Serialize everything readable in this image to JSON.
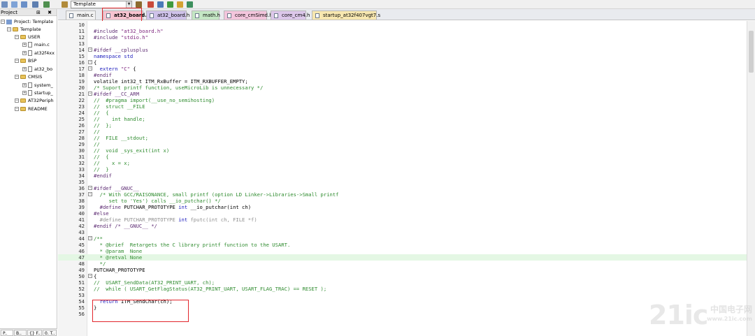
{
  "toolbar": {
    "target": "Template"
  },
  "project": {
    "header": "Project",
    "header_buttons": "⊞ ✖",
    "root": "Project: Template",
    "items": [
      {
        "label": "Template",
        "kind": "target",
        "depth": 1
      },
      {
        "label": "USER",
        "kind": "folder",
        "depth": 2
      },
      {
        "label": "main.c",
        "kind": "file",
        "depth": 3
      },
      {
        "label": "at32f4xx",
        "kind": "file",
        "depth": 3
      },
      {
        "label": "BSP",
        "kind": "folder",
        "depth": 2
      },
      {
        "label": "at32_bo",
        "kind": "file",
        "depth": 3
      },
      {
        "label": "CMSIS",
        "kind": "folder",
        "depth": 2
      },
      {
        "label": "system_",
        "kind": "file",
        "depth": 3
      },
      {
        "label": "startup_",
        "kind": "file",
        "depth": 3
      },
      {
        "label": "AT32Periph",
        "kind": "folder",
        "depth": 2
      },
      {
        "label": "README",
        "kind": "folder",
        "depth": 2
      }
    ],
    "bottom_tabs": [
      "P..",
      "B..",
      "{} F..",
      "0. T.."
    ]
  },
  "tabs": [
    {
      "label": "main.c",
      "color": "#f2f2f2"
    },
    {
      "label": "at32_board.c",
      "color": "#f7c3d0"
    },
    {
      "label": "at32_board.h",
      "color": "#cfc2ea"
    },
    {
      "label": "math.h",
      "color": "#c4e6c4"
    },
    {
      "label": "core_cmSimd.h",
      "color": "#f3c5dc"
    },
    {
      "label": "core_cm4.h",
      "color": "#dcc7ea"
    },
    {
      "label": "startup_at32f407vgt7.s",
      "color": "#f7e7b0"
    }
  ],
  "code": [
    {
      "n": "10",
      "segs": []
    },
    {
      "n": "11",
      "segs": [
        {
          "t": "#include ",
          "c": "pp"
        },
        {
          "t": "\"at32_board.h\"",
          "c": "str"
        }
      ]
    },
    {
      "n": "12",
      "segs": [
        {
          "t": "#include ",
          "c": "pp"
        },
        {
          "t": "\"stdio.h\"",
          "c": "str"
        }
      ]
    },
    {
      "n": "13",
      "segs": []
    },
    {
      "n": "14",
      "fold": "−",
      "segs": [
        {
          "t": "#ifdef __cplusplus",
          "c": "pp"
        }
      ]
    },
    {
      "n": "15",
      "segs": [
        {
          "t": "namespace std",
          "c": "kw"
        }
      ]
    },
    {
      "n": "16",
      "fold": "−",
      "segs": [
        {
          "t": "{",
          "c": "tx"
        }
      ]
    },
    {
      "n": "17",
      "fold": "−",
      "segs": [
        {
          "t": "  extern ",
          "c": "kw"
        },
        {
          "t": "\"C\"",
          "c": "str"
        },
        {
          "t": " {",
          "c": "tx"
        }
      ]
    },
    {
      "n": "18",
      "segs": [
        {
          "t": "#endif",
          "c": "pp"
        }
      ]
    },
    {
      "n": "19",
      "segs": [
        {
          "t": "volatile int32_t ITM_RxBuffer = ITM_RXBUFFER_EMPTY;",
          "c": "tx"
        }
      ]
    },
    {
      "n": "20",
      "segs": [
        {
          "t": "/* Suport printf function, useMicroLib is unnecessary */",
          "c": "cm"
        }
      ]
    },
    {
      "n": "21",
      "fold": "−",
      "segs": [
        {
          "t": "#ifdef __CC_ARM",
          "c": "pp"
        }
      ]
    },
    {
      "n": "22",
      "segs": [
        {
          "t": "//  #pragma import(__use_no_semihosting)",
          "c": "cm"
        }
      ]
    },
    {
      "n": "23",
      "segs": [
        {
          "t": "//  struct __FILE",
          "c": "cm"
        }
      ]
    },
    {
      "n": "24",
      "segs": [
        {
          "t": "//  {",
          "c": "cm"
        }
      ]
    },
    {
      "n": "25",
      "segs": [
        {
          "t": "//    int handle;",
          "c": "cm"
        }
      ]
    },
    {
      "n": "26",
      "segs": [
        {
          "t": "//  };",
          "c": "cm"
        }
      ]
    },
    {
      "n": "27",
      "segs": [
        {
          "t": "//",
          "c": "cm"
        }
      ]
    },
    {
      "n": "28",
      "segs": [
        {
          "t": "//  FILE __stdout;",
          "c": "cm"
        }
      ]
    },
    {
      "n": "29",
      "segs": [
        {
          "t": "//",
          "c": "cm"
        }
      ]
    },
    {
      "n": "30",
      "segs": [
        {
          "t": "//  void _sys_exit(int x)",
          "c": "cm"
        }
      ]
    },
    {
      "n": "31",
      "segs": [
        {
          "t": "//  {",
          "c": "cm"
        }
      ]
    },
    {
      "n": "32",
      "segs": [
        {
          "t": "//    x = x;",
          "c": "cm"
        }
      ]
    },
    {
      "n": "33",
      "segs": [
        {
          "t": "//  }",
          "c": "cm"
        }
      ]
    },
    {
      "n": "34",
      "segs": [
        {
          "t": "#endif",
          "c": "pp"
        }
      ]
    },
    {
      "n": "35",
      "segs": []
    },
    {
      "n": "36",
      "fold": "−",
      "segs": [
        {
          "t": "#ifdef __GNUC__",
          "c": "pp"
        }
      ]
    },
    {
      "n": "37",
      "fold": "−",
      "segs": [
        {
          "t": "  /* With GCC/RAISONANCE, small printf (option LD Linker->Libraries->Small printf",
          "c": "cm"
        }
      ]
    },
    {
      "n": "38",
      "segs": [
        {
          "t": "     set to 'Yes') calls __io_putchar() */",
          "c": "cm"
        }
      ]
    },
    {
      "n": "39",
      "segs": [
        {
          "t": "  #define ",
          "c": "pp"
        },
        {
          "t": "PUTCHAR_PROTOTYPE ",
          "c": "tx"
        },
        {
          "t": "int",
          "c": "kw"
        },
        {
          "t": " __io_putchar(int ch)",
          "c": "tx"
        }
      ]
    },
    {
      "n": "40",
      "segs": [
        {
          "t": "#else",
          "c": "pp"
        }
      ]
    },
    {
      "n": "41",
      "segs": [
        {
          "t": "  #define PUTCHAR_PROTOTYPE ",
          "c": "dis"
        },
        {
          "t": "int",
          "c": "kw"
        },
        {
          "t": " fputc(int ch, FILE *f)",
          "c": "dis"
        }
      ]
    },
    {
      "n": "42",
      "segs": [
        {
          "t": "#endif /* __GNUC__ */",
          "c": "pp"
        }
      ]
    },
    {
      "n": "43",
      "segs": []
    },
    {
      "n": "44",
      "fold": "−",
      "segs": [
        {
          "t": "/**",
          "c": "cm"
        }
      ]
    },
    {
      "n": "45",
      "segs": [
        {
          "t": "  * @brief  Retargets the C library printf function to the USART.",
          "c": "cm"
        }
      ]
    },
    {
      "n": "46",
      "segs": [
        {
          "t": "  * @param  None",
          "c": "cm"
        }
      ]
    },
    {
      "n": "47",
      "cur": true,
      "segs": [
        {
          "t": "  * @retval None",
          "c": "cm"
        }
      ]
    },
    {
      "n": "48",
      "segs": [
        {
          "t": "  */",
          "c": "cm"
        }
      ]
    },
    {
      "n": "49",
      "segs": [
        {
          "t": "PUTCHAR_PROTOTYPE",
          "c": "tx"
        }
      ]
    },
    {
      "n": "50",
      "fold": "−",
      "segs": [
        {
          "t": "{",
          "c": "tx"
        }
      ]
    },
    {
      "n": "51",
      "segs": [
        {
          "t": "//  USART_SendData(AT32_PRINT_UART, ch);",
          "c": "cm"
        }
      ]
    },
    {
      "n": "52",
      "segs": [
        {
          "t": "//  while ( USART_GetFlagStatus(AT32_PRINT_UART, USART_FLAG_TRAC) == RESET );",
          "c": "cm"
        }
      ]
    },
    {
      "n": "53",
      "segs": []
    },
    {
      "n": "54",
      "segs": [
        {
          "t": "  return ",
          "c": "kw"
        },
        {
          "t": "ITM_SendChar(ch);",
          "c": "tx"
        }
      ]
    },
    {
      "n": "55",
      "segs": [
        {
          "t": "}",
          "c": "tx"
        }
      ]
    },
    {
      "n": "56",
      "segs": []
    }
  ],
  "watermark": {
    "big": "21ic",
    "small": "中国电子网",
    "url": "www.21ic.com"
  }
}
